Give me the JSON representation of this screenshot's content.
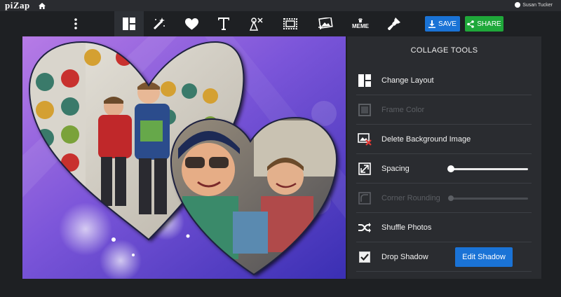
{
  "app": {
    "logo": "piZap",
    "user_name": "Susan Tucker"
  },
  "toolbar": {
    "tools": [
      "more-icon",
      "layout-icon",
      "magic-wand-icon",
      "heart-icon",
      "text-icon",
      "stickers-icon",
      "border-icon",
      "add-photo-icon",
      "meme-icon",
      "paint-brush-icon"
    ],
    "meme_label": "MEME",
    "save_label": "SAVE",
    "share_label": "SHARE"
  },
  "panel": {
    "title": "COLLAGE TOOLS",
    "change_layout": "Change Layout",
    "frame_color": "Frame Color",
    "delete_background": "Delete Background Image",
    "spacing": "Spacing",
    "corner_rounding": "Corner Rounding",
    "shuffle_photos": "Shuffle Photos",
    "drop_shadow": "Drop Shadow",
    "edit_shadow": "Edit Shadow",
    "spacing_value": 0,
    "corner_rounding_value": 0,
    "drop_shadow_checked": true
  },
  "colors": {
    "accent_blue": "#1a73d6",
    "share_green": "#1fa83a",
    "panel_bg": "#2a2c30"
  }
}
